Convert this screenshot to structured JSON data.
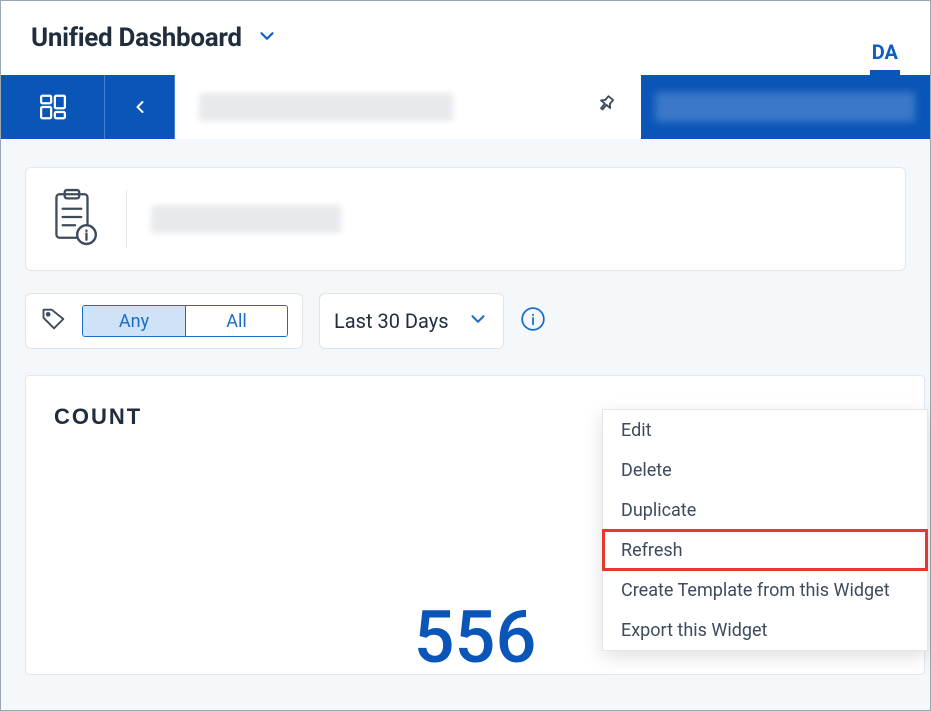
{
  "header": {
    "title": "Unified Dashboard",
    "right_tab": "DA"
  },
  "filter": {
    "segmented": {
      "any": "Any",
      "all": "All"
    },
    "date_range": "Last 30 Days"
  },
  "widget": {
    "title": "COUNT",
    "value": "556"
  },
  "context_menu": {
    "edit": "Edit",
    "delete": "Delete",
    "duplicate": "Duplicate",
    "refresh": "Refresh",
    "create_template": "Create Template from this Widget",
    "export": "Export this Widget"
  }
}
